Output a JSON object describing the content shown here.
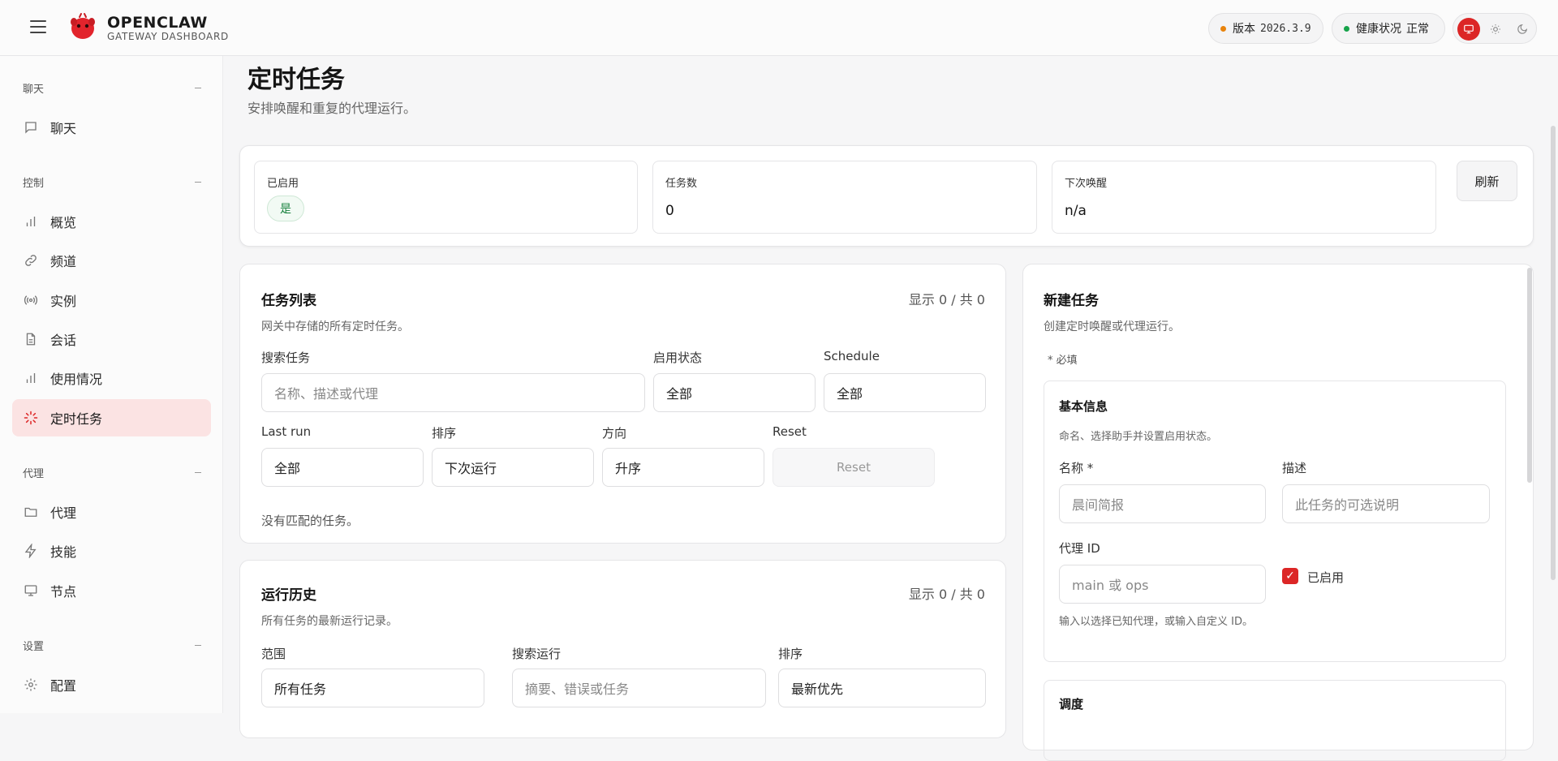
{
  "header": {
    "brand_title": "OPENCLAW",
    "brand_sub": "GATEWAY DASHBOARD",
    "version_label": "版本",
    "version_value": "2026.3.9",
    "health_label": "健康状况",
    "health_value": "正常",
    "version_dot_color": "#e8830c",
    "health_dot_color": "#16a34a"
  },
  "sidebar": {
    "sections": [
      {
        "title": "聊天",
        "items": [
          {
            "label": "聊天",
            "icon": "message-icon"
          }
        ]
      },
      {
        "title": "控制",
        "items": [
          {
            "label": "概览",
            "icon": "bar-chart-icon"
          },
          {
            "label": "频道",
            "icon": "link-icon"
          },
          {
            "label": "实例",
            "icon": "radio-icon"
          },
          {
            "label": "会话",
            "icon": "file-icon"
          },
          {
            "label": "使用情况",
            "icon": "bar-chart-icon"
          },
          {
            "label": "定时任务",
            "icon": "spinner-icon"
          }
        ]
      },
      {
        "title": "代理",
        "items": [
          {
            "label": "代理",
            "icon": "folder-icon"
          },
          {
            "label": "技能",
            "icon": "zap-icon"
          },
          {
            "label": "节点",
            "icon": "monitor-icon"
          }
        ]
      },
      {
        "title": "设置",
        "items": [
          {
            "label": "配置",
            "icon": "gear-icon"
          }
        ]
      }
    ],
    "active": "定时任务"
  },
  "page": {
    "title": "定时任务",
    "subtitle": "安排唤醒和重复的代理运行。"
  },
  "stats": {
    "enabled_label": "已启用",
    "enabled_value": "是",
    "tasks_label": "任务数",
    "tasks_value": "0",
    "next_label": "下次唤醒",
    "next_value": "n/a",
    "refresh": "刷新"
  },
  "task_list": {
    "title": "任务列表",
    "count": "显示 0 / 共 0",
    "desc": "网关中存储的所有定时任务。",
    "search_label": "搜索任务",
    "search_placeholder": "名称、描述或代理",
    "enabled_label": "启用状态",
    "enabled_value": "全部",
    "schedule_label": "Schedule",
    "schedule_value": "全部",
    "lastrun_label": "Last run",
    "lastrun_value": "全部",
    "sort_label": "排序",
    "sort_value": "下次运行",
    "dir_label": "方向",
    "dir_value": "升序",
    "reset_label": "Reset",
    "reset_button": "Reset",
    "empty": "没有匹配的任务。"
  },
  "history": {
    "title": "运行历史",
    "count": "显示 0 / 共 0",
    "desc": "所有任务的最新运行记录。",
    "scope_label": "范围",
    "scope_value": "所有任务",
    "search_label": "搜索运行",
    "search_placeholder": "摘要、错误或任务",
    "sort_label": "排序",
    "sort_value": "最新优先"
  },
  "new_task": {
    "title": "新建任务",
    "desc": "创建定时唤醒或代理运行。",
    "required": "* 必填",
    "basic_title": "基本信息",
    "basic_desc": "命名、选择助手并设置启用状态。",
    "name_label": "名称 *",
    "name_placeholder": "晨间简报",
    "desc_label": "描述",
    "desc_placeholder": "此任务的可选说明",
    "agent_label": "代理 ID",
    "agent_placeholder": "main 或 ops",
    "enabled_label": "已启用",
    "agent_hint": "输入以选择已知代理，或输入自定义 ID。",
    "schedule_title": "调度"
  }
}
